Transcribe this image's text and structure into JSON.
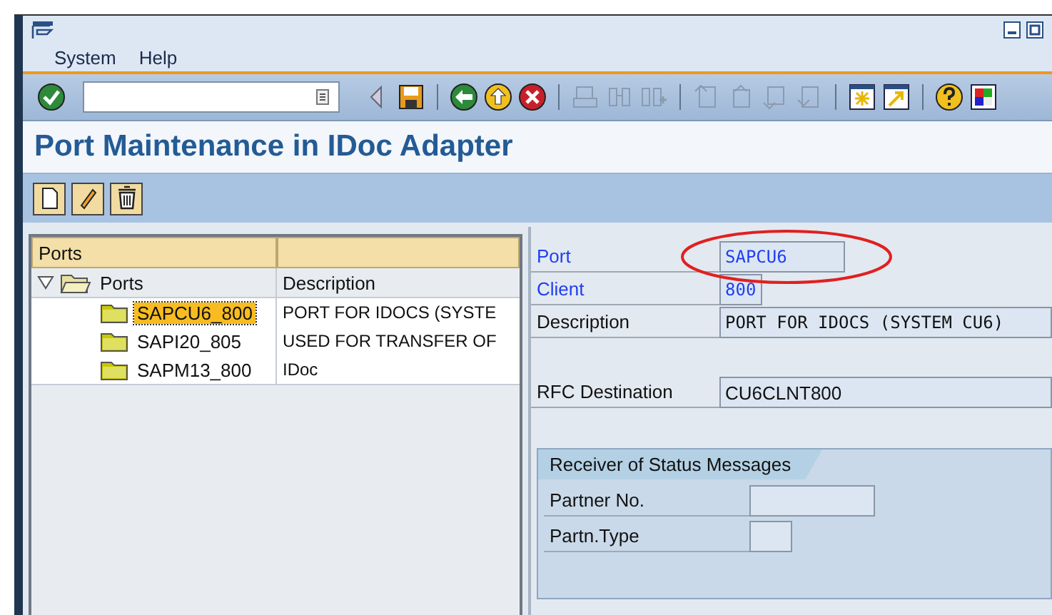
{
  "menu": [
    {
      "label": "System"
    },
    {
      "label": "Help"
    }
  ],
  "page_title": "Port Maintenance in IDoc Adapter",
  "tree": {
    "header": "Ports",
    "root": {
      "label": "Ports",
      "description": "Description",
      "expanded": true,
      "children": [
        {
          "label": "SAPCU6_800",
          "description": "PORT FOR IDOCS (SYSTE",
          "selected": true
        },
        {
          "label": "SAPI20_805",
          "description": "USED FOR TRANSFER OF",
          "selected": false
        },
        {
          "label": "SAPM13_800",
          "description": "IDoc",
          "selected": false
        }
      ]
    }
  },
  "form": {
    "fields": [
      {
        "label": "Port",
        "value": "SAPCU6",
        "required": true
      },
      {
        "label": "Client",
        "value": "800",
        "required": true
      },
      {
        "label": "Description",
        "value": "PORT FOR IDOCS (SYSTEM CU6)",
        "required": false
      },
      {
        "label": "RFC Destination",
        "value": "CU6CLNT800",
        "required": false
      }
    ]
  },
  "group": {
    "title": "Receiver of Status Messages",
    "fields": [
      {
        "label": "Partner No."
      },
      {
        "label": "Partn.Type"
      }
    ]
  }
}
